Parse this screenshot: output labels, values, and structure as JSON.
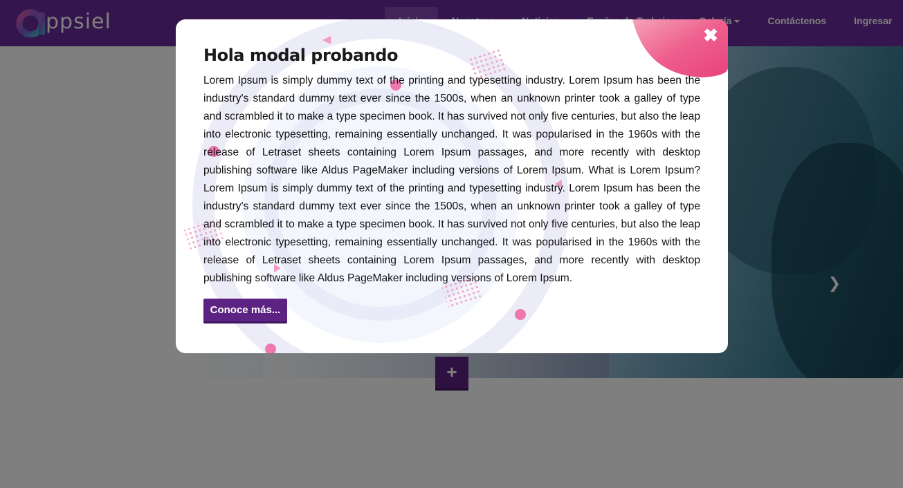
{
  "navbar": {
    "logo_text": "ppsiel",
    "items": [
      {
        "label": "Inicio"
      },
      {
        "label": "Nosotros"
      },
      {
        "label": "Noticias"
      },
      {
        "label": "Equipo de Trabajo"
      },
      {
        "label": "Galería"
      },
      {
        "label": "Contáctenos"
      },
      {
        "label": "Ingresar"
      }
    ]
  },
  "hero": {
    "next_icon": "chevron-right-icon",
    "plus_label": "+"
  },
  "modal": {
    "title": "Hola modal probando",
    "close_label": "✖",
    "body": "Lorem Ipsum is simply dummy text of the printing and typesetting industry. Lorem Ipsum has been the industry's standard dummy text ever since the 1500s, when an unknown printer took a galley of type and scrambled it to make a type specimen book. It has survived not only five centuries, but also the leap into electronic typesetting, remaining essentially unchanged. It was popularised in the 1960s with the release of Letraset sheets containing Lorem Ipsum passages, and more recently with desktop publishing software like Aldus PageMaker including versions of Lorem Ipsum. What is Lorem Ipsum? Lorem Ipsum is simply dummy text of the printing and typesetting industry. Lorem Ipsum has been the industry's standard dummy text ever since the 1500s, when an unknown printer took a galley of type and scrambled it to make a type specimen book. It has survived not only five centuries, but also the leap into electronic typesetting, remaining essentially unchanged. It was popularised in the 1960s with the release of Letraset sheets containing Lorem Ipsum passages, and more recently with desktop publishing software like Aldus PageMaker including versions of Lorem Ipsum.",
    "button_label": "Conoce más..."
  },
  "colors": {
    "navbar": "#6a2a9a",
    "accent_purple": "#5c2383",
    "pink": "#e8609e",
    "ring": "#e7e6f7"
  }
}
